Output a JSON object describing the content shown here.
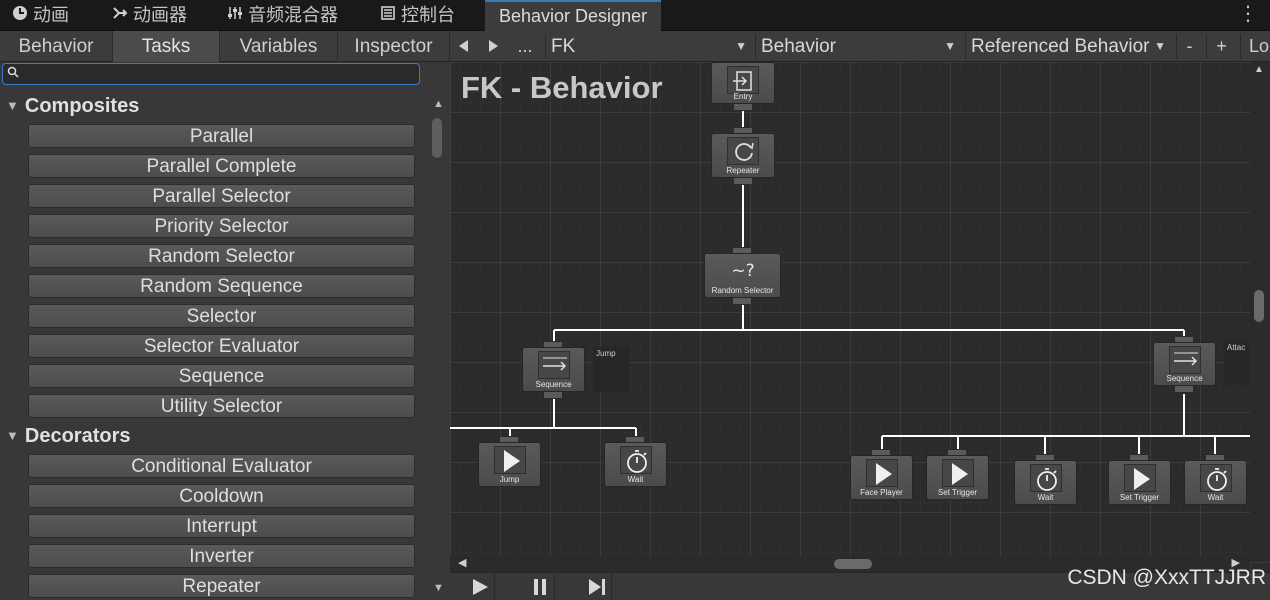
{
  "window_tabs": [
    {
      "label": "动画",
      "icon": "animation-clock-icon"
    },
    {
      "label": "动画器",
      "icon": "animator-icon"
    },
    {
      "label": "音频混合器",
      "icon": "audio-mixer-icon"
    },
    {
      "label": "控制台",
      "icon": "console-icon"
    },
    {
      "label": "Behavior Designer",
      "icon": "",
      "active": true
    }
  ],
  "panel_tabs": [
    "Behavior",
    "Tasks",
    "Variables",
    "Inspector"
  ],
  "selected_panel_tab": "Tasks",
  "toolbar": {
    "more_label": "...",
    "object_dropdown": "FK",
    "behavior_dropdown": "Behavior",
    "referenced_dropdown": "Referenced Behavior",
    "minus_label": "-",
    "plus_label": "+",
    "lock_label": "Lo"
  },
  "search": {
    "value": "",
    "placeholder": ""
  },
  "task_categories": [
    {
      "name": "Composites",
      "items": [
        "Parallel",
        "Parallel Complete",
        "Parallel Selector",
        "Priority Selector",
        "Random Selector",
        "Random Sequence",
        "Selector",
        "Selector Evaluator",
        "Sequence",
        "Utility Selector"
      ]
    },
    {
      "name": "Decorators",
      "items": [
        "Conditional Evaluator",
        "Cooldown",
        "Interrupt",
        "Inverter",
        "Repeater"
      ]
    }
  ],
  "graph": {
    "title": "FK - Behavior",
    "nodes": [
      {
        "label": "Entry",
        "icon": "entry-icon"
      },
      {
        "label": "Repeater",
        "icon": "repeat-icon"
      },
      {
        "label": "Random Selector",
        "icon": "random-selector-icon"
      },
      {
        "label": "Sequence",
        "icon": "sequence-arrow-icon",
        "comment": "Jump"
      },
      {
        "label": "Jump",
        "icon": "play-icon"
      },
      {
        "label": "Wait",
        "icon": "stopwatch-icon"
      },
      {
        "label": "Sequence",
        "icon": "sequence-arrow-icon",
        "comment": "Attac"
      },
      {
        "label": "Face Player",
        "icon": "play-icon"
      },
      {
        "label": "Set Trigger",
        "icon": "play-icon"
      },
      {
        "label": "Wait",
        "icon": "stopwatch-icon"
      },
      {
        "label": "Set Trigger",
        "icon": "play-icon"
      },
      {
        "label": "Wait",
        "icon": "stopwatch-icon"
      }
    ]
  },
  "player_controls": [
    "play-icon",
    "pause-icon",
    "step-icon"
  ],
  "watermark": "CSDN @XxxTTJJRR"
}
